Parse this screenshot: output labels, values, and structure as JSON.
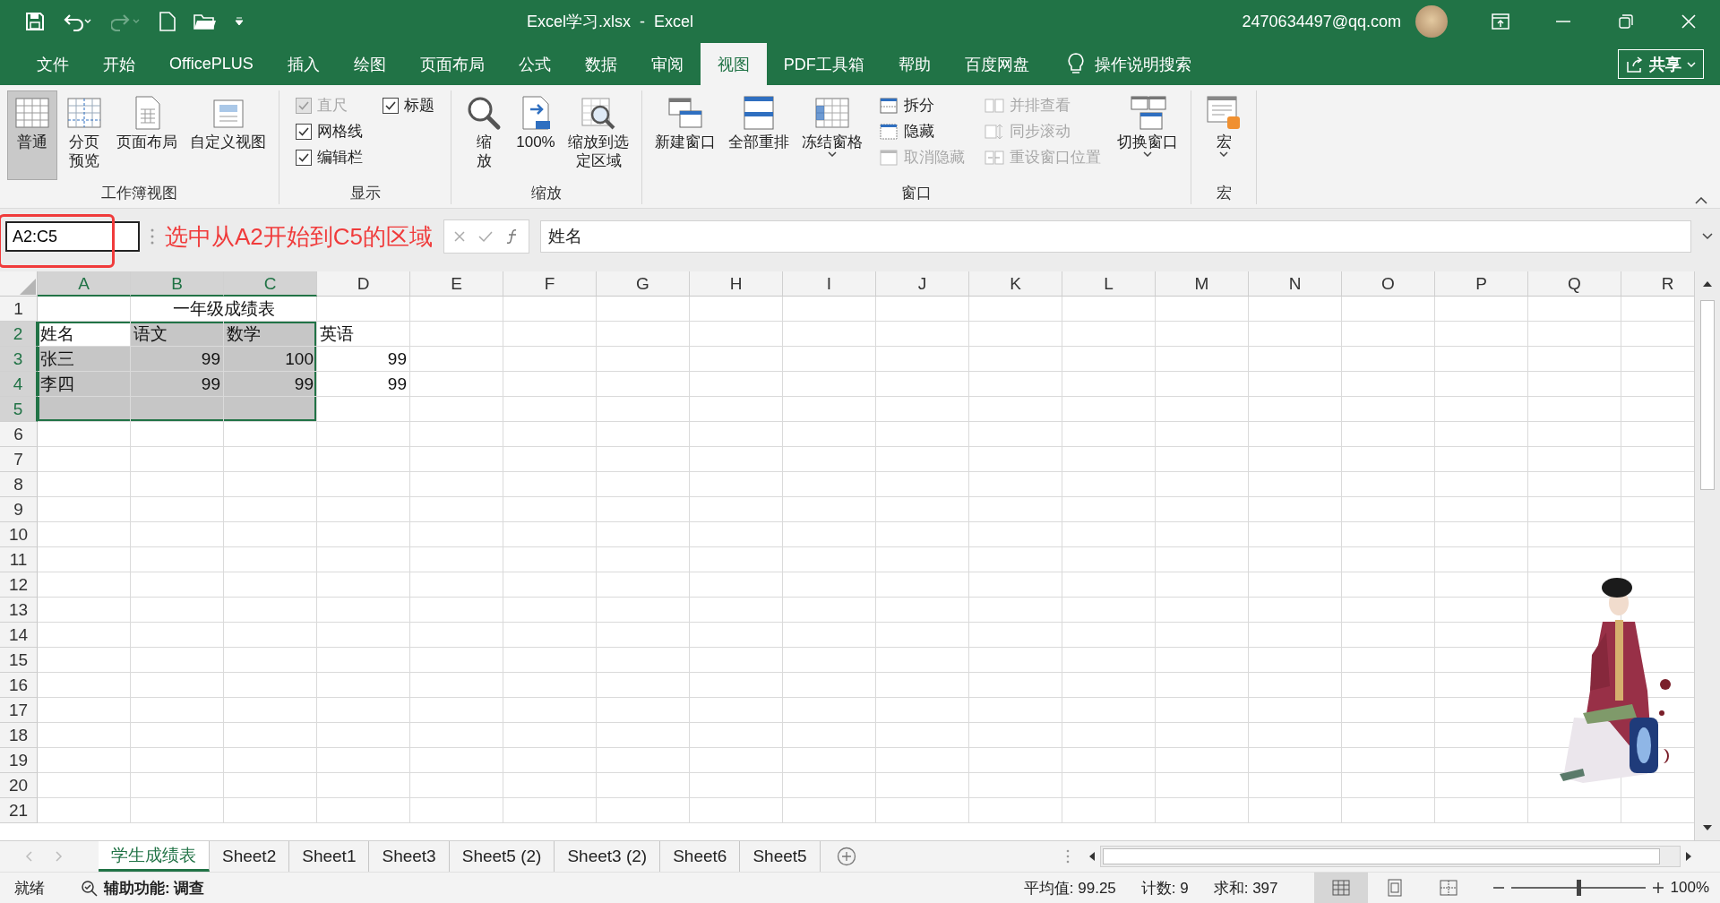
{
  "title_bar": {
    "title": "Excel学习.xlsx  -  Excel",
    "account": "2470634497@qq.com"
  },
  "menu_tabs": [
    {
      "label": "文件",
      "selected": false
    },
    {
      "label": "开始",
      "selected": false
    },
    {
      "label": "OfficePLUS",
      "selected": false
    },
    {
      "label": "插入",
      "selected": false
    },
    {
      "label": "绘图",
      "selected": false
    },
    {
      "label": "页面布局",
      "selected": false
    },
    {
      "label": "公式",
      "selected": false
    },
    {
      "label": "数据",
      "selected": false
    },
    {
      "label": "审阅",
      "selected": false
    },
    {
      "label": "视图",
      "selected": true
    },
    {
      "label": "PDF工具箱",
      "selected": false
    },
    {
      "label": "帮助",
      "selected": false
    },
    {
      "label": "百度网盘",
      "selected": false
    }
  ],
  "tell_me": {
    "placeholder": "操作说明搜索"
  },
  "share_button": "共享",
  "ribbon": {
    "groups": [
      {
        "label": "工作簿视图",
        "items": [
          {
            "kind": "large",
            "label": "普通",
            "selected": true
          },
          {
            "kind": "tall",
            "label": "分页预览",
            "selected": false
          },
          {
            "kind": "large",
            "label": "页面布局",
            "selected": false
          },
          {
            "kind": "large",
            "label": "自定义视图",
            "selected": false
          }
        ]
      },
      {
        "label": "显示",
        "items": [
          {
            "kind": "checkbox",
            "label": "直尺",
            "checked": true,
            "disabled": true
          },
          {
            "kind": "checkbox",
            "label": "网格线",
            "checked": true,
            "disabled": false
          },
          {
            "kind": "checkbox",
            "label": "编辑栏",
            "checked": true,
            "disabled": false
          },
          {
            "kind": "checkbox",
            "label": "标题",
            "checked": true,
            "disabled": false
          }
        ]
      },
      {
        "label": "缩放",
        "items": [
          {
            "kind": "tall",
            "label": "缩放",
            "dropdown": false
          },
          {
            "kind": "large",
            "label": "100%",
            "dropdown": false
          },
          {
            "kind": "tall",
            "label": "缩放到选定区域",
            "dropdown": false
          }
        ]
      },
      {
        "label": "窗口",
        "items": [
          {
            "kind": "large",
            "label": "新建窗口",
            "dropdown": false
          },
          {
            "kind": "large",
            "label": "全部重排",
            "dropdown": false
          },
          {
            "kind": "large",
            "label": "冻结窗格",
            "dropdown": true
          },
          {
            "kind": "small",
            "label": "拆分",
            "disabled": false
          },
          {
            "kind": "small",
            "label": "隐藏",
            "disabled": false
          },
          {
            "kind": "small",
            "label": "取消隐藏",
            "disabled": true
          },
          {
            "kind": "small",
            "label": "并排查看",
            "disabled": true
          },
          {
            "kind": "small",
            "label": "同步滚动",
            "disabled": true
          },
          {
            "kind": "small",
            "label": "重设窗口位置",
            "disabled": true
          },
          {
            "kind": "large",
            "label": "切换窗口",
            "dropdown": true
          }
        ]
      },
      {
        "label": "宏",
        "items": [
          {
            "kind": "large",
            "label": "宏",
            "dropdown": true
          }
        ]
      }
    ]
  },
  "formula_bar": {
    "name_box": "A2:C5",
    "annotation": "选中从A2开始到C5的区域",
    "value": "姓名"
  },
  "grid": {
    "columns": [
      {
        "label": "A",
        "selected": true
      },
      {
        "label": "B",
        "selected": true
      },
      {
        "label": "C",
        "selected": true
      },
      {
        "label": "D",
        "selected": false
      },
      {
        "label": "E",
        "selected": false
      },
      {
        "label": "F",
        "selected": false
      },
      {
        "label": "G",
        "selected": false
      },
      {
        "label": "H",
        "selected": false
      },
      {
        "label": "I",
        "selected": false
      },
      {
        "label": "J",
        "selected": false
      },
      {
        "label": "K",
        "selected": false
      },
      {
        "label": "L",
        "selected": false
      },
      {
        "label": "M",
        "selected": false
      },
      {
        "label": "N",
        "selected": false
      },
      {
        "label": "O",
        "selected": false
      },
      {
        "label": "P",
        "selected": false
      },
      {
        "label": "Q",
        "selected": false
      },
      {
        "label": "R",
        "selected": false
      }
    ],
    "rows": [
      {
        "label": "1",
        "selected": false,
        "cells": [
          null,
          {
            "text": "一年级成绩表",
            "kind": "merged",
            "selected": false
          }
        ]
      },
      {
        "label": "2",
        "selected": true,
        "cells": [
          {
            "text": "姓名",
            "kind": "text",
            "selected": true,
            "active": true
          },
          {
            "text": "语文",
            "kind": "text",
            "selected": true,
            "active": false
          },
          {
            "text": "数学",
            "kind": "text",
            "selected": true,
            "active": false
          },
          {
            "text": "英语",
            "kind": "text",
            "selected": false
          }
        ]
      },
      {
        "label": "3",
        "selected": true,
        "cells": [
          {
            "text": "张三",
            "kind": "text",
            "selected": true,
            "active": false
          },
          {
            "text": "99",
            "kind": "number",
            "selected": true,
            "active": false
          },
          {
            "text": "100",
            "kind": "number",
            "selected": true,
            "active": false
          },
          {
            "text": "99",
            "kind": "number",
            "selected": false
          }
        ]
      },
      {
        "label": "4",
        "selected": true,
        "cells": [
          {
            "text": "李四",
            "kind": "text",
            "selected": true,
            "active": false
          },
          {
            "text": "99",
            "kind": "number",
            "selected": true,
            "active": false
          },
          {
            "text": "99",
            "kind": "number",
            "selected": true,
            "active": false
          },
          {
            "text": "99",
            "kind": "number",
            "selected": false
          }
        ]
      },
      {
        "label": "5",
        "selected": true,
        "cells": [
          {
            "kind": "empty",
            "selected": true,
            "active": false
          },
          {
            "kind": "empty",
            "selected": true,
            "active": false
          },
          {
            "kind": "empty",
            "selected": true,
            "active": false
          }
        ]
      },
      {
        "label": "6",
        "selected": false
      },
      {
        "label": "7",
        "selected": false
      },
      {
        "label": "8",
        "selected": false
      },
      {
        "label": "9",
        "selected": false
      },
      {
        "label": "10",
        "selected": false
      },
      {
        "label": "11",
        "selected": false
      },
      {
        "label": "12",
        "selected": false
      },
      {
        "label": "13",
        "selected": false
      },
      {
        "label": "14",
        "selected": false
      },
      {
        "label": "15",
        "selected": false
      },
      {
        "label": "16",
        "selected": false
      },
      {
        "label": "17",
        "selected": false
      },
      {
        "label": "18",
        "selected": false
      },
      {
        "label": "19",
        "selected": false
      },
      {
        "label": "20",
        "selected": false
      },
      {
        "label": "21",
        "selected": false
      }
    ]
  },
  "sheet_tabs": [
    {
      "label": "学生成绩表",
      "selected": true
    },
    {
      "label": "Sheet2",
      "selected": false
    },
    {
      "label": "Sheet1",
      "selected": false
    },
    {
      "label": "Sheet3",
      "selected": false
    },
    {
      "label": "Sheet5 (2)",
      "selected": false
    },
    {
      "label": "Sheet3 (2)",
      "selected": false
    },
    {
      "label": "Sheet6",
      "selected": false
    },
    {
      "label": "Sheet5",
      "selected": false
    }
  ],
  "status_bar": {
    "ready": "就绪",
    "accessibility": "辅助功能: 调查",
    "average": "平均值: 99.25",
    "count": "计数: 9",
    "sum": "求和: 397",
    "views": [
      {
        "selected": true
      },
      {
        "selected": false
      },
      {
        "selected": false
      }
    ],
    "zoom": {
      "level": 0.5,
      "label": "100%"
    }
  }
}
